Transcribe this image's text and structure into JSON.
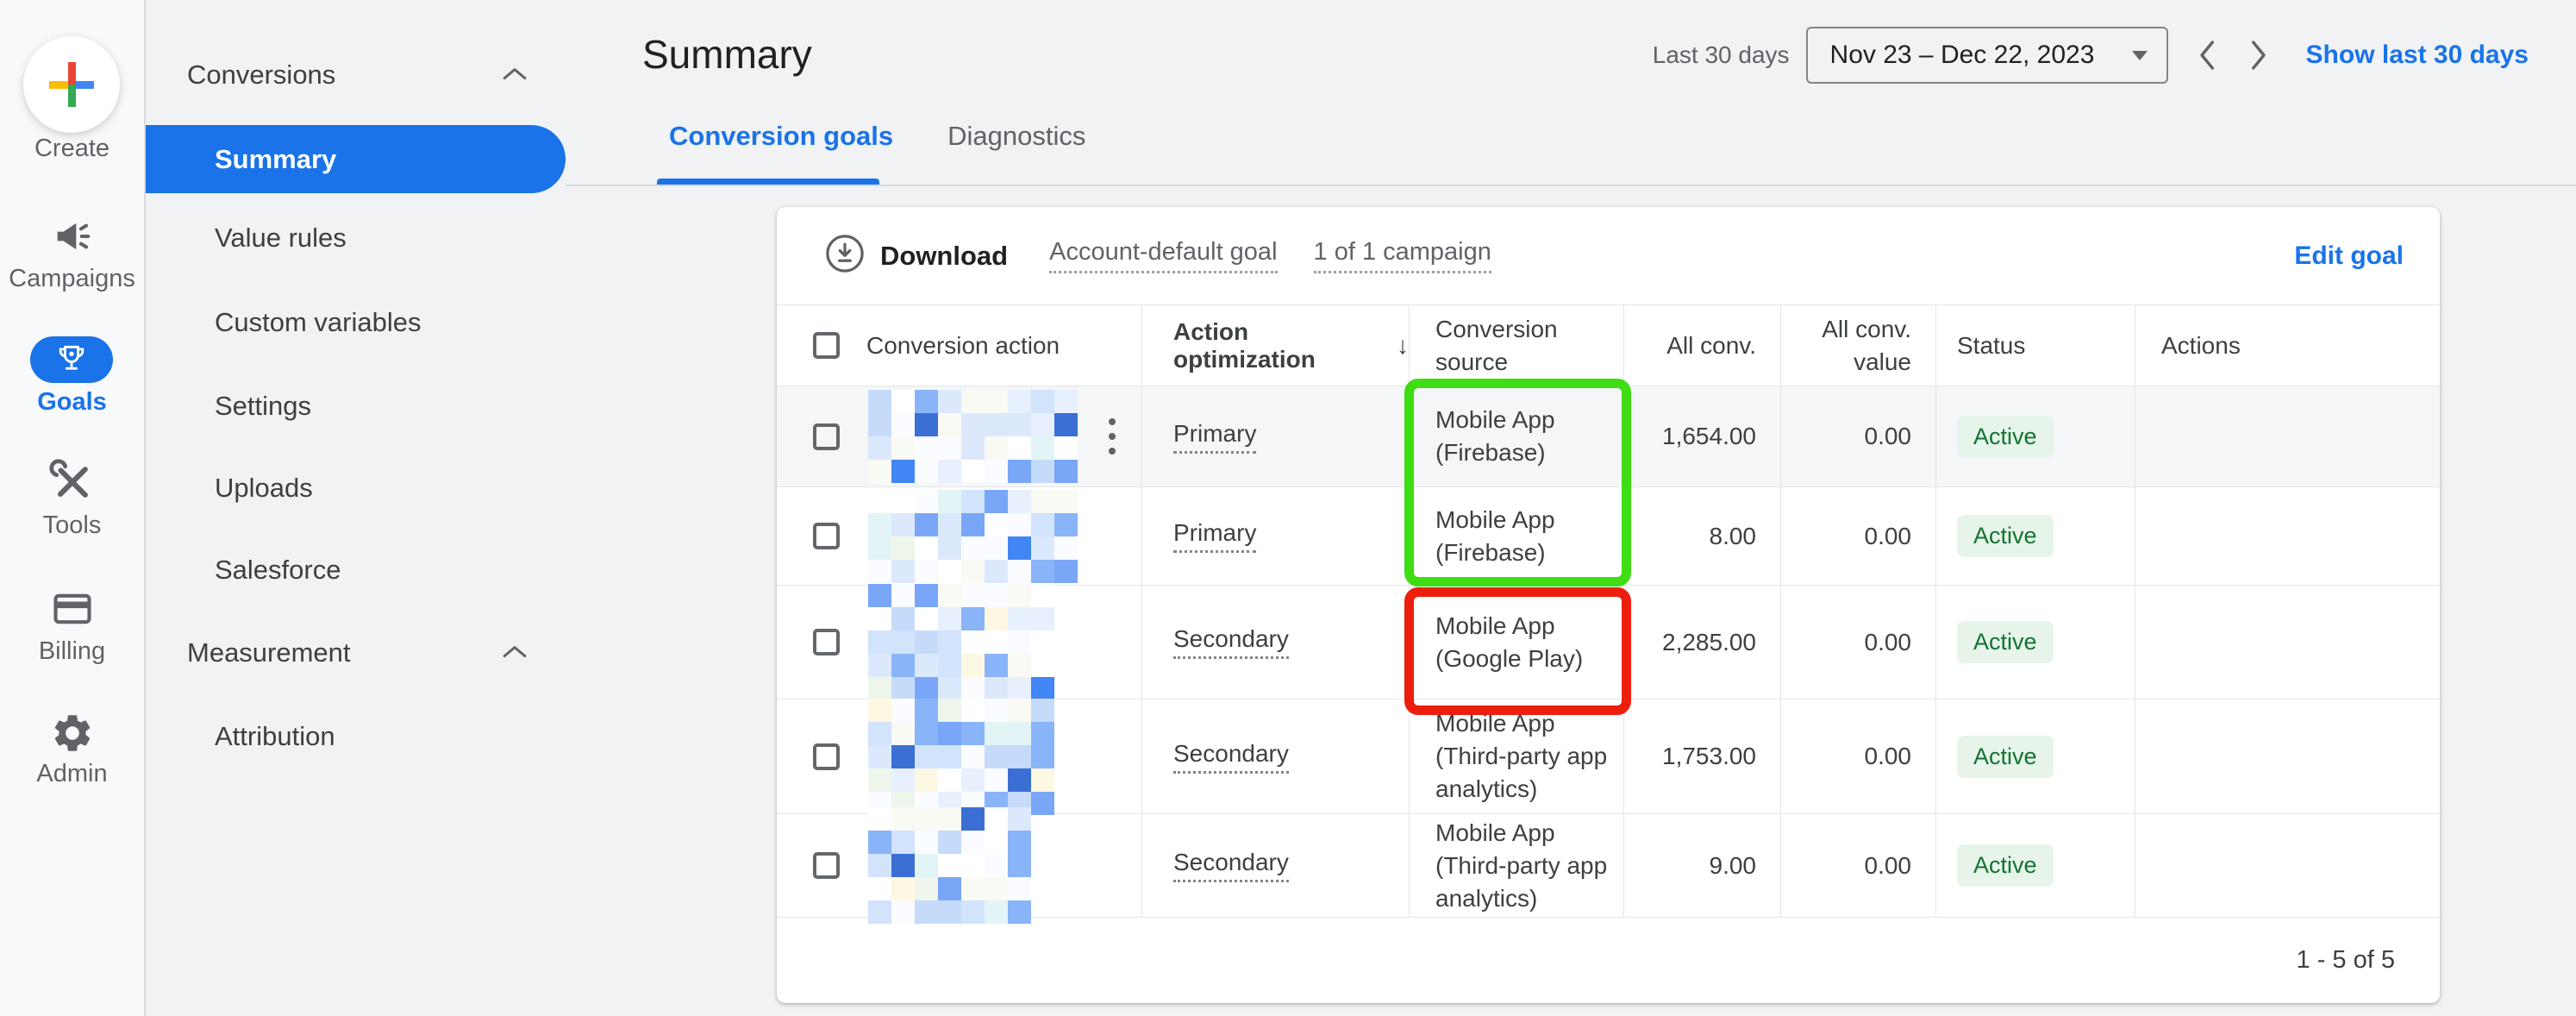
{
  "sidebar": {
    "create": "Create",
    "campaigns": "Campaigns",
    "goals": "Goals",
    "tools": "Tools",
    "billing": "Billing",
    "admin": "Admin"
  },
  "nav": {
    "conversions_header": "Conversions",
    "summary": "Summary",
    "value_rules": "Value rules",
    "custom_variables": "Custom variables",
    "settings": "Settings",
    "uploads": "Uploads",
    "salesforce": "Salesforce",
    "measurement_header": "Measurement",
    "attribution": "Attribution"
  },
  "header": {
    "title": "Summary",
    "date_label": "Last 30 days",
    "date_range": "Nov 23 – Dec 22, 2023",
    "show_link": "Show last 30 days"
  },
  "tabs": {
    "conversion_goals": "Conversion goals",
    "diagnostics": "Diagnostics"
  },
  "toolbar": {
    "download": "Download",
    "account_default_goal": "Account-default goal",
    "campaign_scope": "1 of 1 campaign",
    "edit_goal": "Edit goal"
  },
  "table": {
    "columns": [
      "Conversion action",
      "Action optimization",
      "Conversion source",
      "All conv.",
      "All conv. value",
      "Status",
      "Actions"
    ],
    "rows": [
      {
        "conversion_action": "[redacted]",
        "action_optimization": "Primary",
        "conversion_source": "Mobile App (Firebase)",
        "all_conv": "1,654.00",
        "all_conv_value": "0.00",
        "status": "Active",
        "actions": ""
      },
      {
        "conversion_action": "[redacted]",
        "action_optimization": "Primary",
        "conversion_source": "Mobile App (Firebase)",
        "all_conv": "8.00",
        "all_conv_value": "0.00",
        "status": "Active",
        "actions": ""
      },
      {
        "conversion_action": "[redacted]",
        "action_optimization": "Secondary",
        "conversion_source": "Mobile App (Google Play)",
        "all_conv": "2,285.00",
        "all_conv_value": "0.00",
        "status": "Active",
        "actions": ""
      },
      {
        "conversion_action": "[redacted]",
        "action_optimization": "Secondary",
        "conversion_source": "Mobile App (Third-party app analytics)",
        "all_conv": "1,753.00",
        "all_conv_value": "0.00",
        "status": "Active",
        "actions": ""
      },
      {
        "conversion_action": "[redacted]",
        "action_optimization": "Secondary",
        "conversion_source": "Mobile App (Third-party app analytics)",
        "all_conv": "9.00",
        "all_conv_value": "0.00",
        "status": "Active",
        "actions": ""
      }
    ],
    "pagination": "1 - 5 of 5"
  },
  "annotations": {
    "green_box_rows": [
      1,
      2
    ],
    "red_box_rows": [
      3
    ]
  },
  "colors": {
    "accent_blue": "#1a73e8",
    "highlight_green": "#3fdd13",
    "highlight_red": "#ec1f0e",
    "status_text": "#137333",
    "status_bg": "#e6f4ea"
  }
}
